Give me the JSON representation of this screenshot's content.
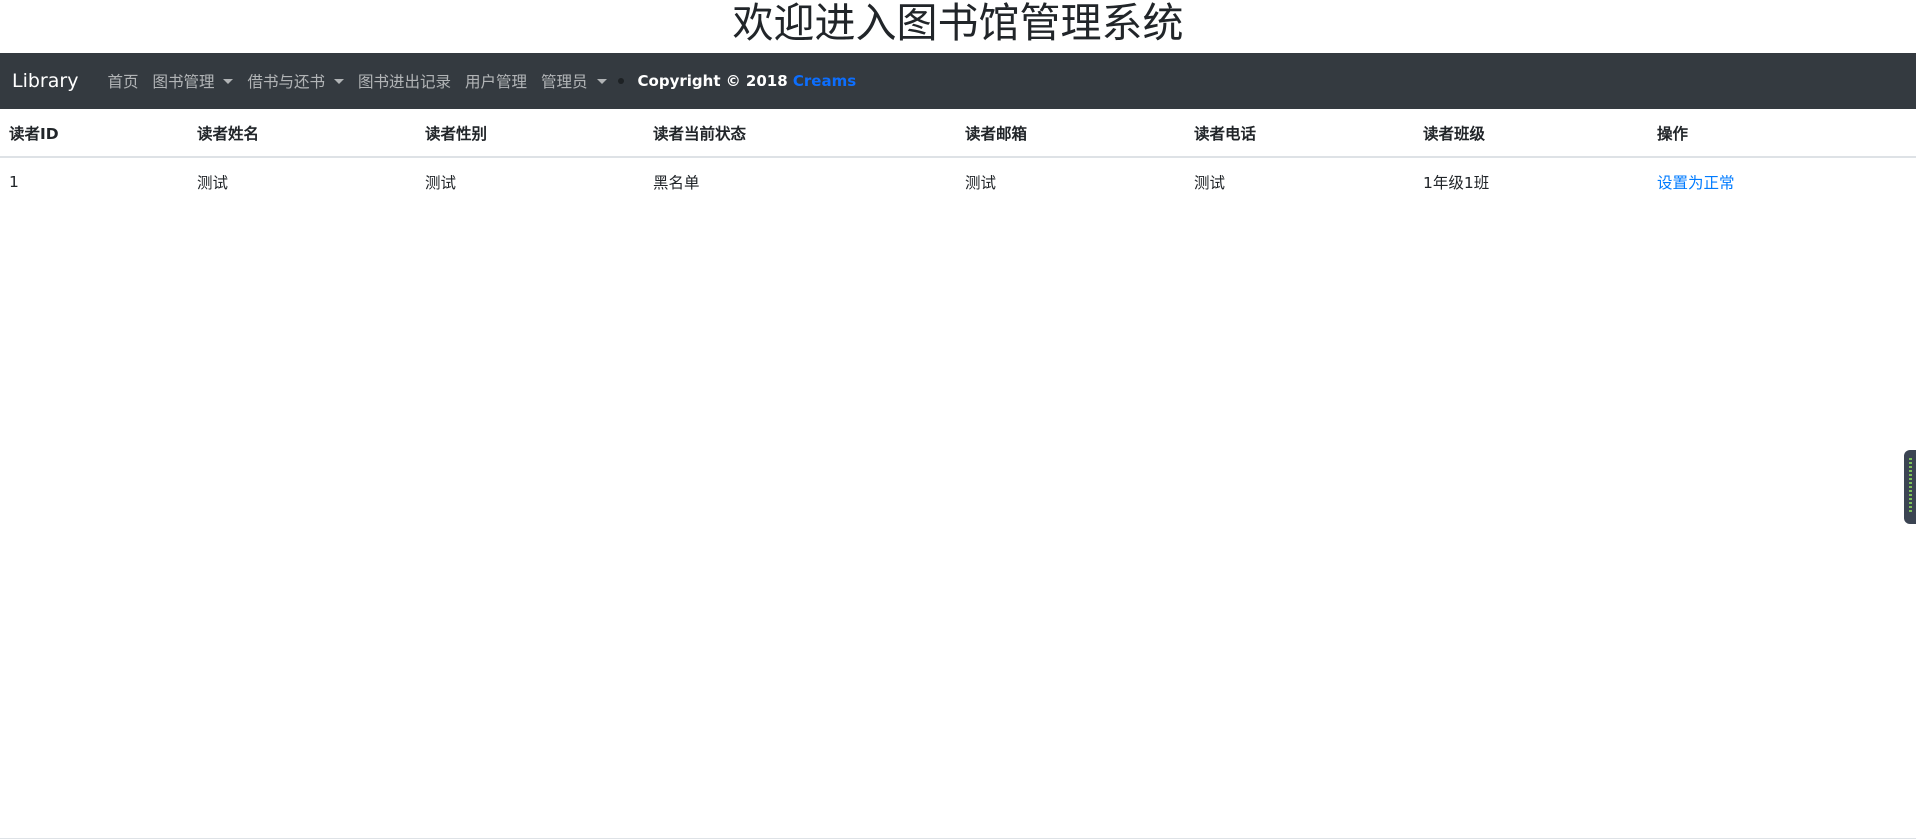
{
  "header": {
    "title": "欢迎进入图书馆管理系统"
  },
  "navbar": {
    "brand": "Library",
    "items": [
      {
        "label": "首页",
        "dropdown": false
      },
      {
        "label": "图书管理",
        "dropdown": true
      },
      {
        "label": "借书与还书",
        "dropdown": true
      },
      {
        "label": "图书进出记录",
        "dropdown": false
      },
      {
        "label": "用户管理",
        "dropdown": false
      },
      {
        "label": "管理员",
        "dropdown": true
      }
    ],
    "copyright_prefix": "Copyright © 2018 ",
    "copyright_author": "Creams"
  },
  "table": {
    "columns": [
      "读者ID",
      "读者姓名",
      "读者性别",
      "读者当前状态",
      "读者邮箱",
      "读者电话",
      "读者班级",
      "操作"
    ],
    "rows": [
      {
        "id": "1",
        "name": "测试",
        "gender": "测试",
        "status": "黑名单",
        "email": "测试",
        "phone": "测试",
        "class": "1年级1班",
        "action": "设置为正常"
      }
    ]
  },
  "colors": {
    "navbar_bg": "#343a40",
    "link": "#007bff",
    "copyright_author": "#0d6efd"
  },
  "icons": {
    "dropdown": "caret-down-icon",
    "separator": "dot-icon"
  }
}
